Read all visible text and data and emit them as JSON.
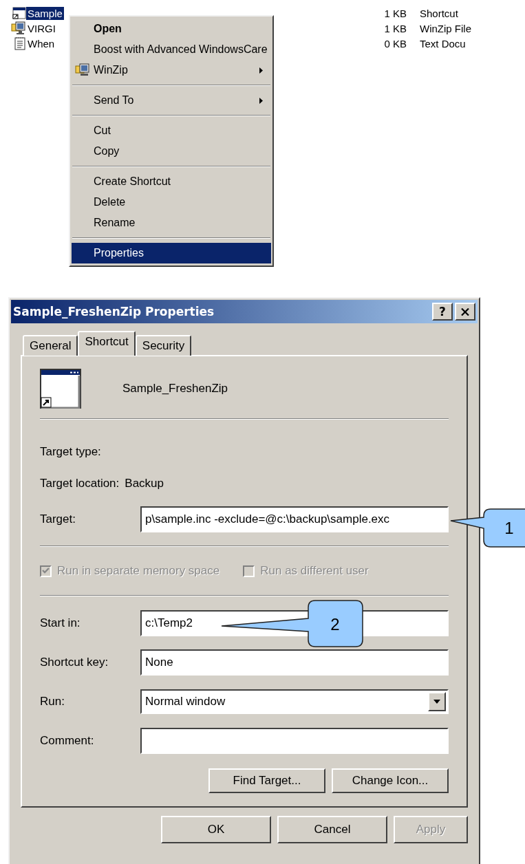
{
  "files": [
    {
      "kind": "shortcut",
      "name": "Sample",
      "size": "1 KB",
      "type": "Shortcut",
      "selected": true
    },
    {
      "kind": "archive",
      "name": "VIRGI",
      "size": "1 KB",
      "type": "WinZip File",
      "selected": false
    },
    {
      "kind": "text",
      "name": "When",
      "size": "0 KB",
      "type": "Text Docu",
      "selected": false
    }
  ],
  "context_menu": {
    "items": [
      {
        "kind": "item",
        "label": "Open",
        "default": true,
        "icon": false,
        "submenu": false,
        "selected": false
      },
      {
        "kind": "item",
        "label": "Boost with Advanced WindowsCare",
        "default": false,
        "icon": false,
        "submenu": false,
        "selected": false
      },
      {
        "kind": "item",
        "label": "WinZip",
        "default": false,
        "icon": true,
        "submenu": true,
        "selected": false
      },
      {
        "kind": "separator"
      },
      {
        "kind": "item",
        "label": "Send To",
        "default": false,
        "icon": false,
        "submenu": true,
        "selected": false
      },
      {
        "kind": "separator"
      },
      {
        "kind": "item",
        "label": "Cut",
        "default": false,
        "icon": false,
        "submenu": false,
        "selected": false
      },
      {
        "kind": "item",
        "label": "Copy",
        "default": false,
        "icon": false,
        "submenu": false,
        "selected": false
      },
      {
        "kind": "separator"
      },
      {
        "kind": "item",
        "label": "Create Shortcut",
        "default": false,
        "icon": false,
        "submenu": false,
        "selected": false
      },
      {
        "kind": "item",
        "label": "Delete",
        "default": false,
        "icon": false,
        "submenu": false,
        "selected": false
      },
      {
        "kind": "item",
        "label": "Rename",
        "default": false,
        "icon": false,
        "submenu": false,
        "selected": false
      },
      {
        "kind": "separator"
      },
      {
        "kind": "item",
        "label": "Properties",
        "default": false,
        "icon": false,
        "submenu": false,
        "selected": true
      }
    ]
  },
  "dialog": {
    "title": "Sample_FreshenZip Properties",
    "help_button": "?",
    "tabs": [
      {
        "label": "General",
        "selected": false
      },
      {
        "label": "Shortcut",
        "selected": true
      },
      {
        "label": "Security",
        "selected": false
      }
    ],
    "shortcut_name": "Sample_FreshenZip",
    "target_type_label": "Target type:",
    "target_location_label": "Target location:",
    "target_location": "Backup",
    "target_label": "Target:",
    "target": "p\\sample.inc -exclude=@c:\\backup\\sample.exc",
    "checkboxes": [
      {
        "label": "Run in separate memory space",
        "checked": true,
        "disabled": true
      },
      {
        "label": "Run as different user",
        "checked": false,
        "disabled": true
      }
    ],
    "fields": [
      {
        "kind": "text",
        "label": "Start in:",
        "value": "c:\\Temp2"
      },
      {
        "kind": "text",
        "label": "Shortcut key:",
        "value": "None"
      },
      {
        "kind": "dropdown",
        "label": "Run:",
        "value": "Normal window"
      },
      {
        "kind": "text",
        "label": "Comment:"
      }
    ],
    "actions": [
      {
        "label": "Find Target...",
        "disabled": false
      },
      {
        "label": "Change Icon...",
        "disabled": false
      }
    ],
    "buttons": [
      {
        "label": "OK",
        "disabled": false
      },
      {
        "label": "Cancel",
        "disabled": false
      },
      {
        "label": "Apply",
        "disabled": true
      }
    ]
  },
  "callouts": [
    {
      "number": "1"
    },
    {
      "number": "2"
    }
  ]
}
